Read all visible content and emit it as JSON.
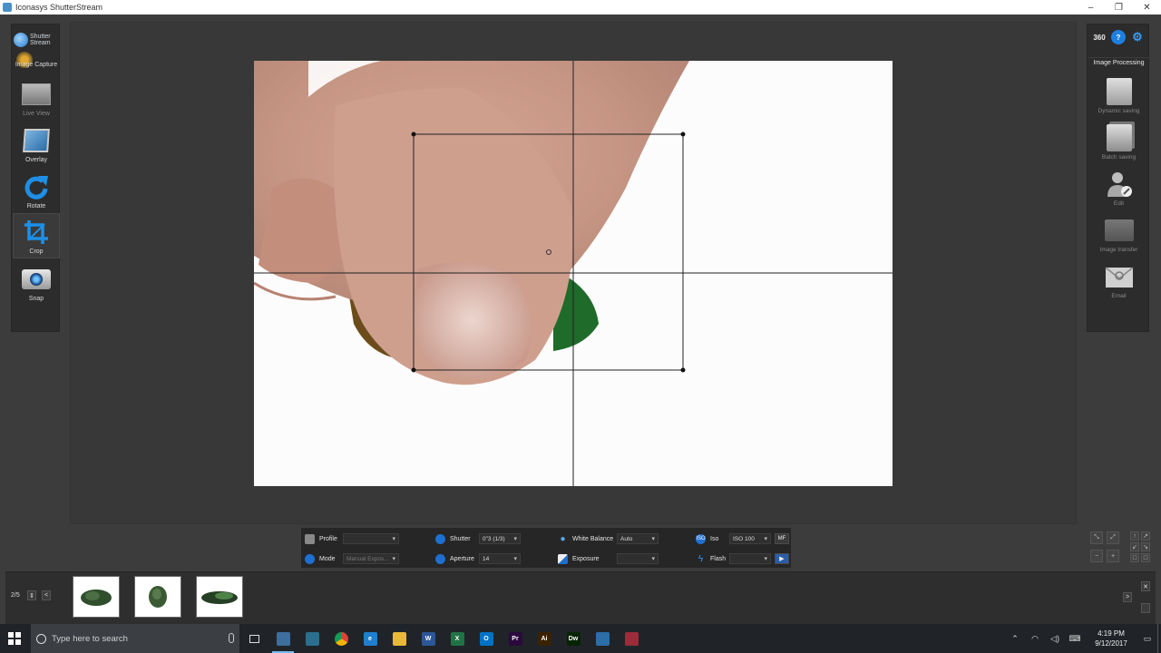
{
  "window": {
    "title": "Iconasys ShutterStream",
    "controls": [
      "–",
      "❐",
      "✕"
    ]
  },
  "logo": {
    "line1": "Shutter",
    "line2": "Stream"
  },
  "left_tools": [
    {
      "label": "Image Capture",
      "icon": "camera-capture-icon"
    },
    {
      "label": "Live View",
      "icon": "monitor-icon"
    },
    {
      "label": "Overlay",
      "icon": "overlay-icon"
    },
    {
      "label": "Rotate",
      "icon": "rotate-icon"
    },
    {
      "label": "Crop",
      "icon": "crop-icon"
    },
    {
      "label": "Snap",
      "icon": "camera-snap-icon"
    }
  ],
  "right_panel": {
    "top_buttons": [
      "360",
      "?",
      "⚙"
    ],
    "heading": "Image Processing",
    "tools": [
      {
        "label": "Dynamic saving",
        "icon": "floppy-icon"
      },
      {
        "label": "Batch saving",
        "icon": "batch-floppy-icon"
      },
      {
        "label": "Edit",
        "icon": "edit-user-icon"
      },
      {
        "label": "Image transfer",
        "icon": "folder-transfer-icon"
      },
      {
        "label": "Email",
        "icon": "email-icon"
      }
    ]
  },
  "controls": {
    "profile": {
      "label": "Profile",
      "value": ""
    },
    "mode": {
      "label": "Mode",
      "value": "Manual Expos..."
    },
    "shutter": {
      "label": "Shutter",
      "value": "0\"3 (1/3)"
    },
    "aperture": {
      "label": "Aperture",
      "value": "14"
    },
    "white_balance": {
      "label": "White Balance",
      "value": "Auto"
    },
    "exposure": {
      "label": "Exposure",
      "value": ""
    },
    "iso": {
      "label": "Iso",
      "value": "ISO 100"
    },
    "flash": {
      "label": "Flash",
      "value": ""
    },
    "mf_label": "MF"
  },
  "filmstrip": {
    "counter": "2/5",
    "prev": "<",
    "next": ">"
  },
  "taskbar": {
    "search_placeholder": "Type here to search",
    "time": "4:19 PM",
    "date": "9/12/2017",
    "apps": [
      {
        "name": "shutterstream",
        "label": "",
        "color": "#3d6e9c"
      },
      {
        "name": "iconasys",
        "label": "",
        "color": "#2a6f8f"
      },
      {
        "name": "chrome",
        "label": "",
        "color": "#e2a51d"
      },
      {
        "name": "edge",
        "label": "e",
        "color": "#1f7fd0"
      },
      {
        "name": "explorer",
        "label": "",
        "color": "#e8b83a"
      },
      {
        "name": "word",
        "label": "W",
        "color": "#2b579a"
      },
      {
        "name": "excel",
        "label": "X",
        "color": "#217346"
      },
      {
        "name": "outlook",
        "label": "O",
        "color": "#0072c6"
      },
      {
        "name": "premiere",
        "label": "Pr",
        "color": "#2a0a3d"
      },
      {
        "name": "illustrator",
        "label": "Ai",
        "color": "#3a2200"
      },
      {
        "name": "dreamweaver",
        "label": "Dw",
        "color": "#072401"
      },
      {
        "name": "app-blue",
        "label": "",
        "color": "#2b6ea8"
      },
      {
        "name": "app-red",
        "label": "",
        "color": "#9c2c3a"
      }
    ]
  }
}
